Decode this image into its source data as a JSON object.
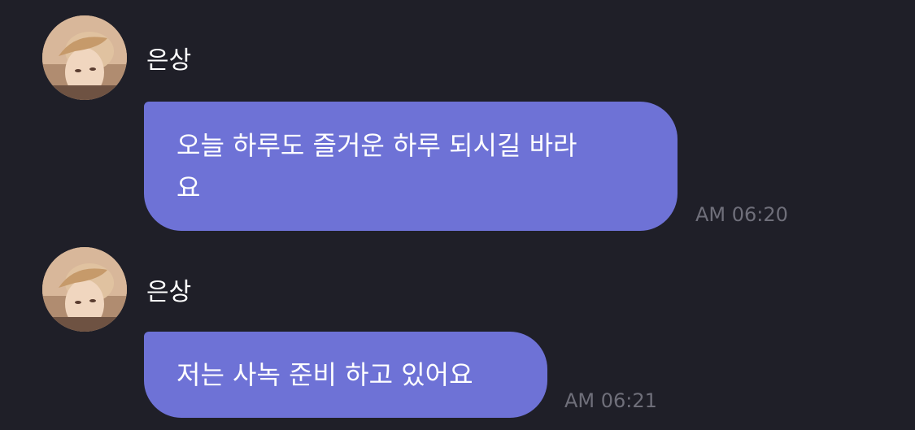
{
  "messages": [
    {
      "sender": "은상",
      "avatar_icon": "profile-photo",
      "text": "오늘 하루도 즐거운 하루 되시길 바라\n요",
      "time": "AM 06:20"
    },
    {
      "sender": "은상",
      "avatar_icon": "profile-photo",
      "text": "저는 사녹 준비 하고 있어요",
      "time": "AM 06:21"
    }
  ],
  "colors": {
    "background": "#1f1f28",
    "bubble": "#6e72d6",
    "timestamp": "#6f6f7a",
    "sender_name": "#ffffff"
  }
}
